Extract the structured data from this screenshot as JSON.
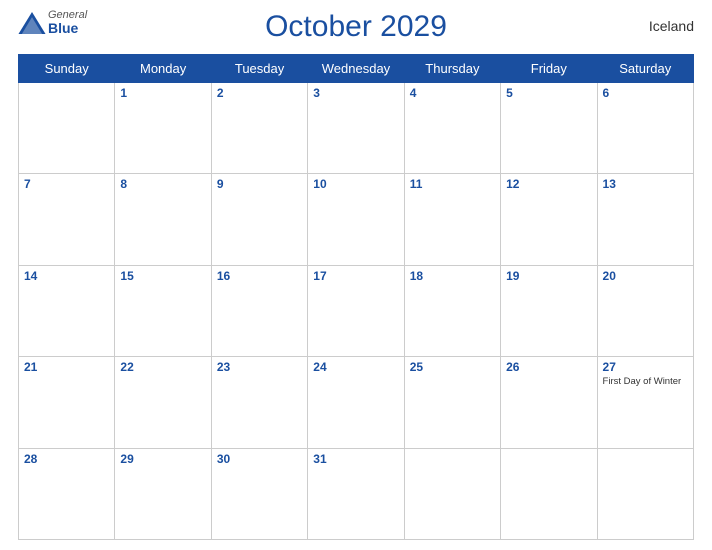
{
  "header": {
    "logo_general": "General",
    "logo_blue": "Blue",
    "title": "October 2029",
    "country": "Iceland"
  },
  "days_of_week": [
    "Sunday",
    "Monday",
    "Tuesday",
    "Wednesday",
    "Thursday",
    "Friday",
    "Saturday"
  ],
  "weeks": [
    [
      {
        "day": "",
        "events": []
      },
      {
        "day": "1",
        "events": []
      },
      {
        "day": "2",
        "events": []
      },
      {
        "day": "3",
        "events": []
      },
      {
        "day": "4",
        "events": []
      },
      {
        "day": "5",
        "events": []
      },
      {
        "day": "6",
        "events": []
      }
    ],
    [
      {
        "day": "7",
        "events": []
      },
      {
        "day": "8",
        "events": []
      },
      {
        "day": "9",
        "events": []
      },
      {
        "day": "10",
        "events": []
      },
      {
        "day": "11",
        "events": []
      },
      {
        "day": "12",
        "events": []
      },
      {
        "day": "13",
        "events": []
      }
    ],
    [
      {
        "day": "14",
        "events": []
      },
      {
        "day": "15",
        "events": []
      },
      {
        "day": "16",
        "events": []
      },
      {
        "day": "17",
        "events": []
      },
      {
        "day": "18",
        "events": []
      },
      {
        "day": "19",
        "events": []
      },
      {
        "day": "20",
        "events": []
      }
    ],
    [
      {
        "day": "21",
        "events": []
      },
      {
        "day": "22",
        "events": []
      },
      {
        "day": "23",
        "events": []
      },
      {
        "day": "24",
        "events": []
      },
      {
        "day": "25",
        "events": []
      },
      {
        "day": "26",
        "events": []
      },
      {
        "day": "27",
        "events": [
          "First Day of Winter"
        ]
      }
    ],
    [
      {
        "day": "28",
        "events": []
      },
      {
        "day": "29",
        "events": []
      },
      {
        "day": "30",
        "events": []
      },
      {
        "day": "31",
        "events": []
      },
      {
        "day": "",
        "events": []
      },
      {
        "day": "",
        "events": []
      },
      {
        "day": "",
        "events": []
      }
    ]
  ]
}
